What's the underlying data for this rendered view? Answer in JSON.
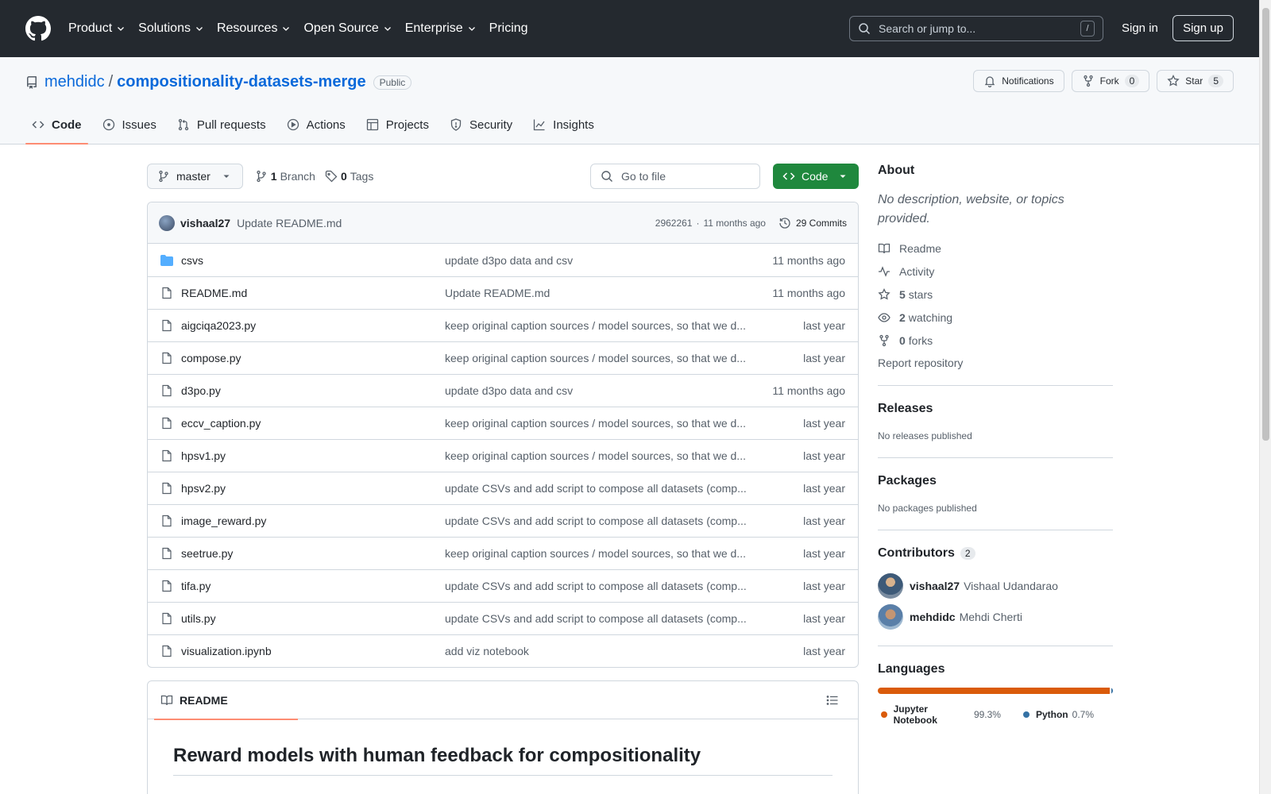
{
  "header": {
    "nav": [
      "Product",
      "Solutions",
      "Resources",
      "Open Source",
      "Enterprise",
      "Pricing"
    ],
    "search_placeholder": "Search or jump to...",
    "slash_key": "/",
    "sign_in": "Sign in",
    "sign_up": "Sign up"
  },
  "repo": {
    "owner": "mehdidc",
    "separator": "/",
    "name": "compositionality-datasets-merge",
    "visibility": "Public",
    "notifications": "Notifications",
    "fork_label": "Fork",
    "fork_count": "0",
    "star_label": "Star",
    "star_count": "5"
  },
  "tabs": [
    {
      "label": "Code",
      "icon": "code-icon"
    },
    {
      "label": "Issues",
      "icon": "issue-icon"
    },
    {
      "label": "Pull requests",
      "icon": "pull-request-icon"
    },
    {
      "label": "Actions",
      "icon": "play-icon"
    },
    {
      "label": "Projects",
      "icon": "table-icon"
    },
    {
      "label": "Security",
      "icon": "shield-icon"
    },
    {
      "label": "Insights",
      "icon": "graph-icon"
    }
  ],
  "toolbar": {
    "branch": "master",
    "branch_count": "1",
    "branch_label": "Branch",
    "tag_count": "0",
    "tag_label": "Tags",
    "go_to_file": "Go to file",
    "code_button": "Code"
  },
  "commit": {
    "author": "vishaal27",
    "message": "Update README.md",
    "hash": "2962261",
    "dot": "·",
    "time": "11 months ago",
    "commits": "29 Commits"
  },
  "files": [
    {
      "name": "csvs",
      "type": "dir",
      "message": "update d3po data and csv",
      "date": "11 months ago"
    },
    {
      "name": "README.md",
      "type": "file",
      "message": "Update README.md",
      "date": "11 months ago"
    },
    {
      "name": "aigciqa2023.py",
      "type": "file",
      "message": "keep original caption sources / model sources, so that we d...",
      "date": "last year"
    },
    {
      "name": "compose.py",
      "type": "file",
      "message": "keep original caption sources / model sources, so that we d...",
      "date": "last year"
    },
    {
      "name": "d3po.py",
      "type": "file",
      "message": "update d3po data and csv",
      "date": "11 months ago"
    },
    {
      "name": "eccv_caption.py",
      "type": "file",
      "message": "keep original caption sources / model sources, so that we d...",
      "date": "last year"
    },
    {
      "name": "hpsv1.py",
      "type": "file",
      "message": "keep original caption sources / model sources, so that we d...",
      "date": "last year"
    },
    {
      "name": "hpsv2.py",
      "type": "file",
      "message": "update CSVs and add script to compose all datasets (comp...",
      "date": "last year"
    },
    {
      "name": "image_reward.py",
      "type": "file",
      "message": "update CSVs and add script to compose all datasets (comp...",
      "date": "last year"
    },
    {
      "name": "seetrue.py",
      "type": "file",
      "message": "keep original caption sources / model sources, so that we d...",
      "date": "last year"
    },
    {
      "name": "tifa.py",
      "type": "file",
      "message": "update CSVs and add script to compose all datasets (comp...",
      "date": "last year"
    },
    {
      "name": "utils.py",
      "type": "file",
      "message": "update CSVs and add script to compose all datasets (comp...",
      "date": "last year"
    },
    {
      "name": "visualization.ipynb",
      "type": "file",
      "message": "add viz notebook",
      "date": "last year"
    }
  ],
  "readme": {
    "tab": "README",
    "title": "Reward models with human feedback for compositionality"
  },
  "about": {
    "heading": "About",
    "description": "No description, website, or topics provided.",
    "readme": "Readme",
    "activity": "Activity",
    "stars_count": "5",
    "stars_label": "stars",
    "watching_count": "2",
    "watching_label": "watching",
    "forks_count": "0",
    "forks_label": "forks",
    "report": "Report repository"
  },
  "releases": {
    "heading": "Releases",
    "text": "No releases published"
  },
  "packages": {
    "heading": "Packages",
    "text": "No packages published"
  },
  "contributors": {
    "heading": "Contributors",
    "count": "2",
    "people": [
      {
        "login": "vishaal27",
        "name": "Vishaal Udandarao"
      },
      {
        "login": "mehdidc",
        "name": "Mehdi Cherti"
      }
    ]
  },
  "languages": {
    "heading": "Languages",
    "items": [
      {
        "name": "Jupyter Notebook",
        "percent": "99.3%",
        "value": 99.3,
        "color": "#DA5B0B"
      },
      {
        "name": "Python",
        "percent": "0.7%",
        "value": 0.7,
        "color": "#3572A5"
      }
    ]
  }
}
